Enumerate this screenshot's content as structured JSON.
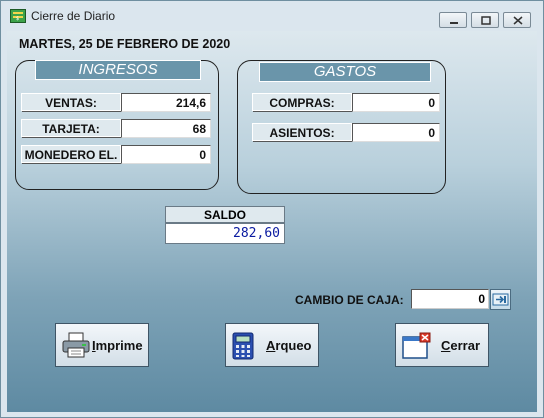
{
  "window": {
    "title": "Cierre de Diario",
    "controls": [
      "minimize-icon",
      "maximize-icon",
      "close-icon"
    ]
  },
  "date": "MARTES, 25 DE FEBRERO DE 2020",
  "ingresos": {
    "header": "INGRESOS",
    "rows": [
      {
        "label": "VENTAS:",
        "value": "214,6"
      },
      {
        "label": "TARJETA:",
        "value": "68"
      },
      {
        "label": "MONEDERO EL.",
        "value": "0"
      }
    ]
  },
  "gastos": {
    "header": "GASTOS",
    "rows": [
      {
        "label": "COMPRAS:",
        "value": "0"
      },
      {
        "label": "ASIENTOS:",
        "value": "0"
      }
    ]
  },
  "saldo": {
    "label": "SALDO",
    "value": "282,60",
    "color": "#0a1aa0"
  },
  "cambio": {
    "label": "CAMBIO DE CAJA:",
    "value": "0"
  },
  "buttons": {
    "imprime": "Imprime",
    "arqueo": "Arqueo",
    "cerrar": "Cerrar"
  },
  "colors": {
    "group_header": "#6a95aa",
    "saldo_text": "#0a1aa0"
  }
}
